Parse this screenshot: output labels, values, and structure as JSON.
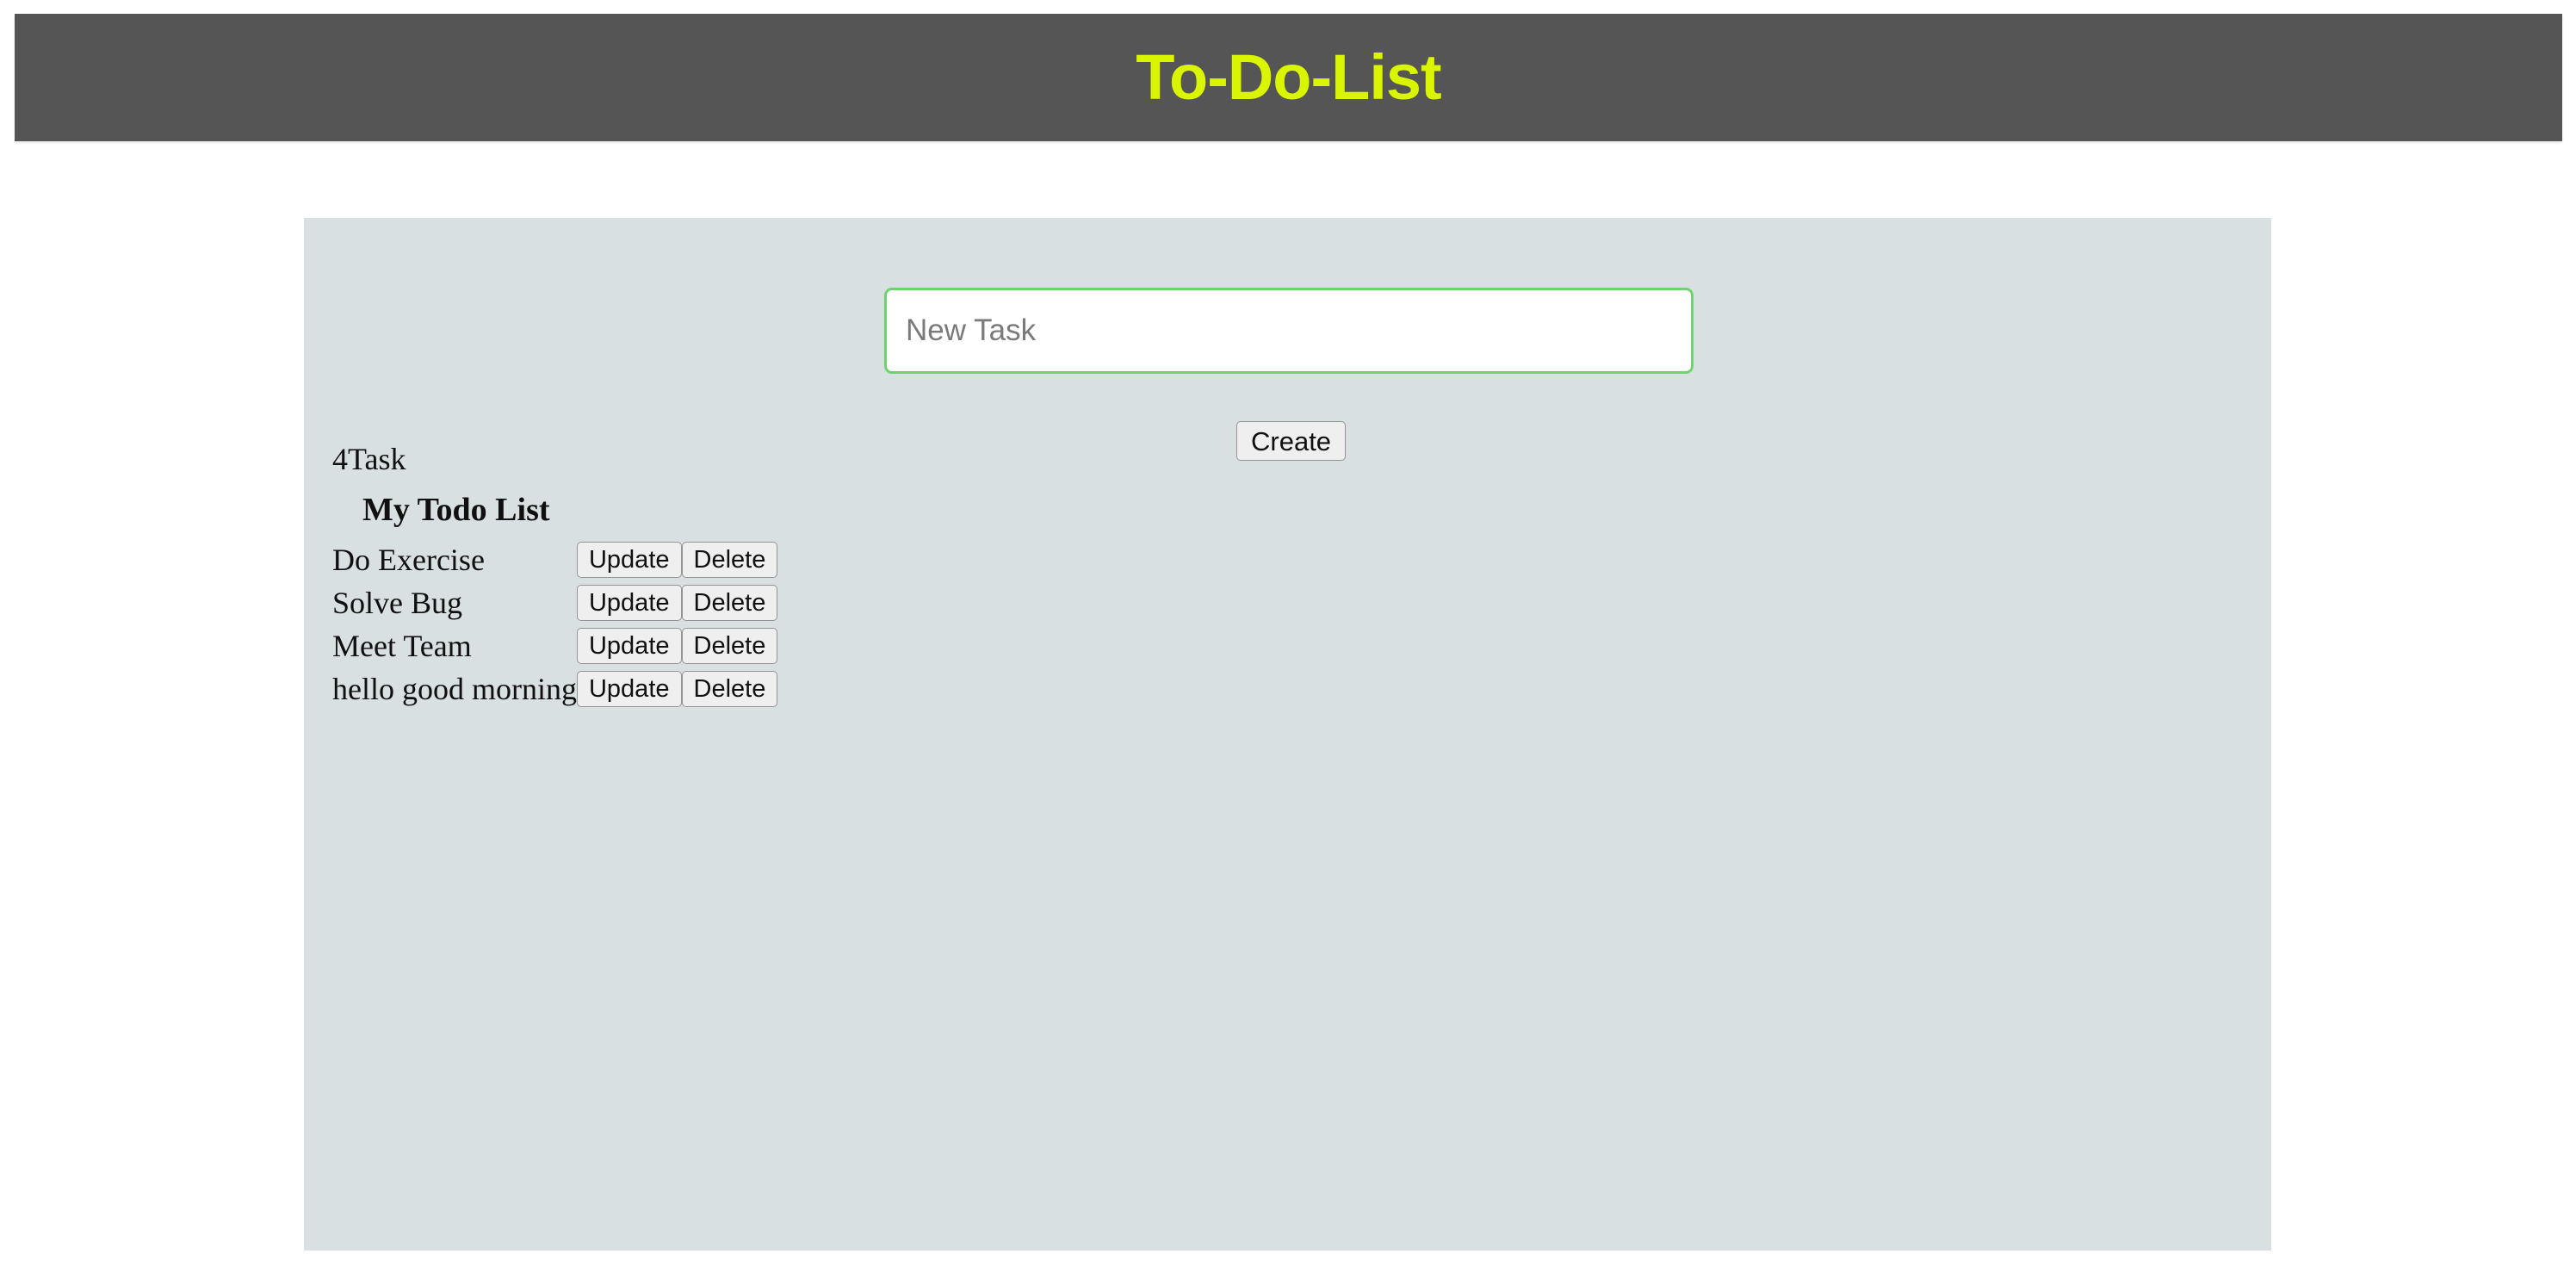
{
  "header": {
    "title": "To-Do-List",
    "background_color": "#555555",
    "title_color": "#d9f500"
  },
  "panel": {
    "background_color": "#d9e0e1"
  },
  "form": {
    "input_placeholder": "New Task",
    "input_value": "",
    "input_border_color": "#6ed36e",
    "create_label": "Create"
  },
  "summary": {
    "count_text": "4Task",
    "count": 4
  },
  "list": {
    "heading": "My Todo List",
    "update_label": "Update",
    "delete_label": "Delete",
    "items": [
      {
        "name": "Do Exercise"
      },
      {
        "name": "Solve Bug"
      },
      {
        "name": "Meet Team"
      },
      {
        "name": "hello good morning"
      }
    ]
  }
}
